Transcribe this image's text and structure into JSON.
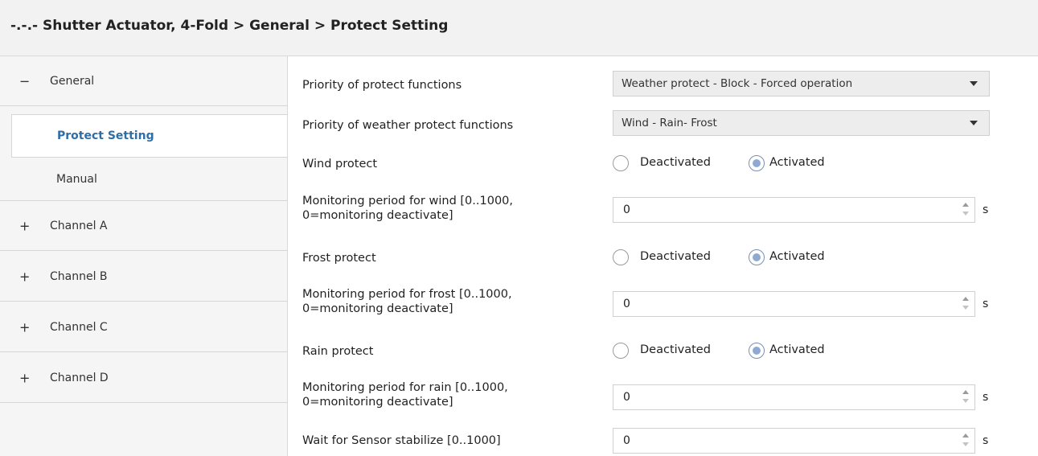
{
  "header": {
    "breadcrumb": "-.-.- Shutter Actuator, 4-Fold > General > Protect Setting"
  },
  "sidebar": {
    "general": {
      "sign": "−",
      "label": "General"
    },
    "sub_items": [
      {
        "label": "Protect Setting"
      },
      {
        "label": "Manual"
      }
    ],
    "channels": [
      {
        "sign": "+",
        "label": "Channel A"
      },
      {
        "sign": "+",
        "label": "Channel B"
      },
      {
        "sign": "+",
        "label": "Channel C"
      },
      {
        "sign": "+",
        "label": "Channel D"
      }
    ]
  },
  "params": {
    "priority_protect": {
      "label": "Priority of protect functions",
      "value": "Weather protect - Block - Forced operation"
    },
    "priority_weather": {
      "label": "Priority of weather protect functions",
      "value": "Wind - Rain- Frost"
    },
    "wind_protect": {
      "label": "Wind protect",
      "opt1": "Deactivated",
      "opt2": "Activated",
      "selected": "Activated"
    },
    "wind_period": {
      "label1": "Monitoring period for wind [0..1000,",
      "label2": "0=monitoring deactivate]",
      "value": "0",
      "unit": "s"
    },
    "frost_protect": {
      "label": "Frost protect",
      "opt1": "Deactivated",
      "opt2": "Activated",
      "selected": "Activated"
    },
    "frost_period": {
      "label1": "Monitoring period for frost [0..1000,",
      "label2": "0=monitoring deactivate]",
      "value": "0",
      "unit": "s"
    },
    "rain_protect": {
      "label": "Rain protect",
      "opt1": "Deactivated",
      "opt2": "Activated",
      "selected": "Activated"
    },
    "rain_period": {
      "label1": "Monitoring period for rain [0..1000,",
      "label2": "0=monitoring deactivate]",
      "value": "0",
      "unit": "s"
    },
    "sensor_wait": {
      "label": "Wait for Sensor stabilize [0..1000]",
      "value": "0",
      "unit": "s"
    }
  },
  "icons": {
    "dropdown": "chevron-down-icon",
    "spinner": "spinner-arrows-icon"
  },
  "colors": {
    "accent": "#2f6da6",
    "radio_selected": "#8faad2"
  }
}
